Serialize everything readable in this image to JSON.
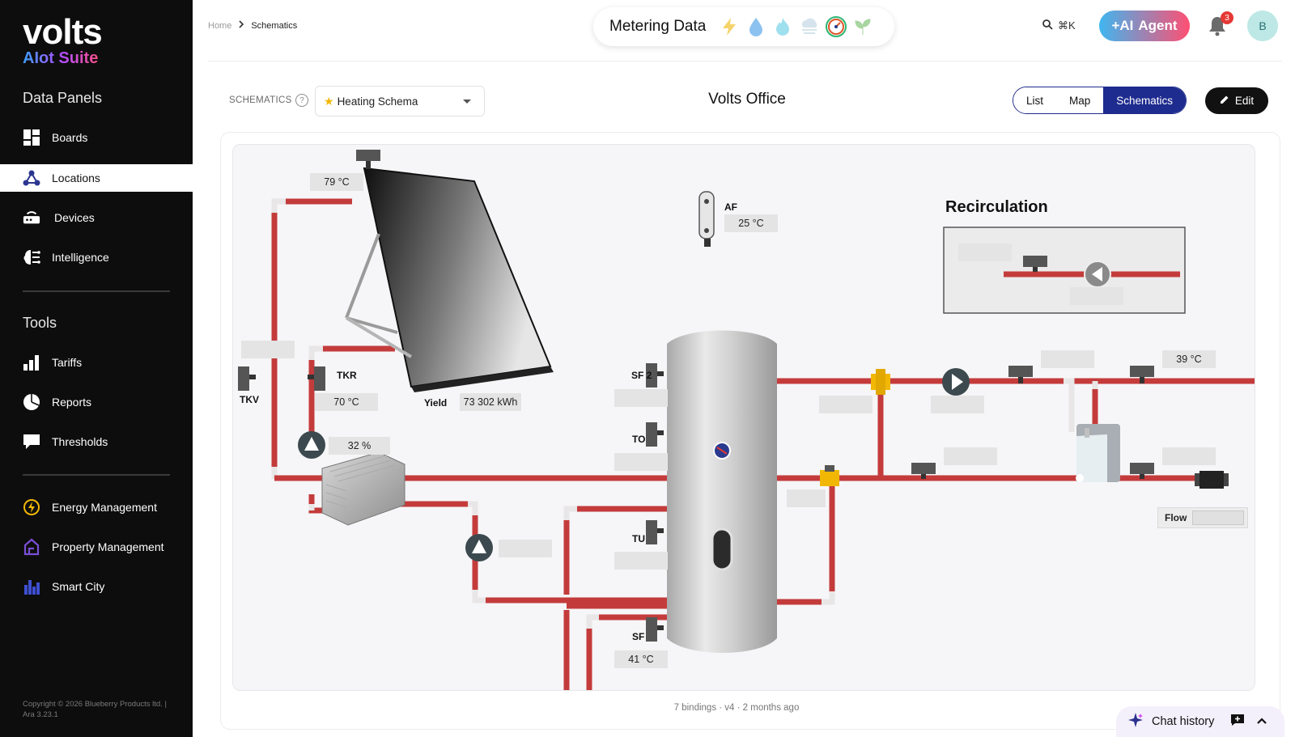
{
  "sidebar": {
    "logo_main": "volts",
    "logo_sub": "AIot Suite",
    "section_data_panels": "Data Panels",
    "section_tools": "Tools",
    "items": [
      {
        "label": "Boards"
      },
      {
        "label": "Locations"
      },
      {
        "label": "Devices"
      },
      {
        "label": "Intelligence"
      },
      {
        "label": "Tariffs"
      },
      {
        "label": "Reports"
      },
      {
        "label": "Thresholds"
      },
      {
        "label": "Energy Management"
      },
      {
        "label": "Property Management"
      },
      {
        "label": "Smart City"
      }
    ],
    "copyright": "Copyright © 2026 Blueberry Products ltd. | Ara 3.23.1"
  },
  "header": {
    "breadcrumb_home": "Home",
    "breadcrumb_current": "Schematics",
    "metering_title": "Metering Data",
    "search_shortcut": "⌘K",
    "agent_label": "Agent",
    "notification_count": "3",
    "avatar_initial": "B"
  },
  "toolbar": {
    "schematics_label": "SCHEMATICS",
    "help_glyph": "?",
    "schema_value": "Heating Schema",
    "title": "Volts Office",
    "views": [
      "List",
      "Map",
      "Schematics"
    ],
    "selected_view": "Schematics",
    "edit_label": "Edit"
  },
  "schematic": {
    "collector_temp": "79 °C",
    "af_tag": "AF",
    "af_value": "25 °C",
    "recirculation_title": "Recirculation",
    "tkv_tag": "TKV",
    "tkr_tag": "TKR",
    "tkr_value": "70 °C",
    "yield_tag": "Yield",
    "yield_value": "73 302 kWh",
    "pump_percent": "32 %",
    "sf2_tag": "SF 2",
    "to_tag": "TO",
    "tu_tag": "TU",
    "sf_tag": "SF",
    "sf_value": "41 °C",
    "right_temp": "39 °C",
    "flow_label": "Flow"
  },
  "footer": {
    "meta": "7 bindings · v4 · 2 months ago",
    "chat_history": "Chat history"
  },
  "colors": {
    "pipe_red": "#c43b3b",
    "pipe_insulation": "#e8e6e6",
    "accent_blue": "#1e2b8f",
    "sidebar_bg": "#0d0d0d"
  }
}
